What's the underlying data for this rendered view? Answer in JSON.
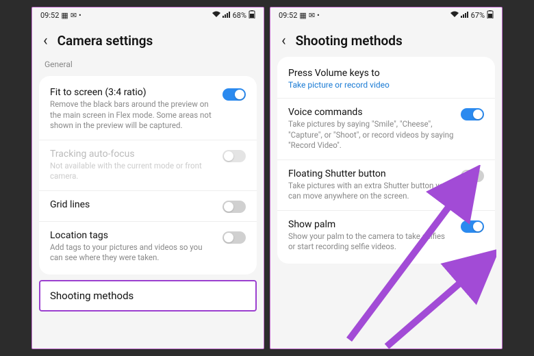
{
  "left": {
    "status": {
      "time": "09:52",
      "battery": "68%"
    },
    "header": {
      "title": "Camera settings"
    },
    "section_label": "General",
    "items": [
      {
        "title": "Fit to screen (3:4 ratio)",
        "desc": "Remove the black bars around the preview on the main screen in Flex mode. Some areas not shown in the preview will be captured.",
        "toggle": "on"
      },
      {
        "title": "Tracking auto-focus",
        "desc": "Not available with the current mode or front camera.",
        "toggle": "off-disabled",
        "disabled": true
      },
      {
        "title": "Grid lines",
        "toggle": "off"
      },
      {
        "title": "Location tags",
        "desc": "Add tags to your pictures and videos so you can see where they were taken.",
        "toggle": "off"
      }
    ],
    "highlight": {
      "title": "Shooting methods"
    }
  },
  "right": {
    "status": {
      "time": "09:52",
      "battery": "67%"
    },
    "header": {
      "title": "Shooting methods"
    },
    "items": [
      {
        "title": "Press Volume keys to",
        "link": "Take picture or record video"
      },
      {
        "title": "Voice commands",
        "desc": "Take pictures by saying \"Smile\", \"Cheese\", \"Capture\", or \"Shoot\", or record videos by saying \"Record Video\".",
        "toggle": "on"
      },
      {
        "title": "Floating Shutter button",
        "desc": "Take pictures with an extra Shutter button you can move anywhere on the screen.",
        "toggle": "off"
      },
      {
        "title": "Show palm",
        "desc": "Show your palm to the camera to take selfies or start recording selfie videos.",
        "toggle": "on"
      }
    ]
  }
}
